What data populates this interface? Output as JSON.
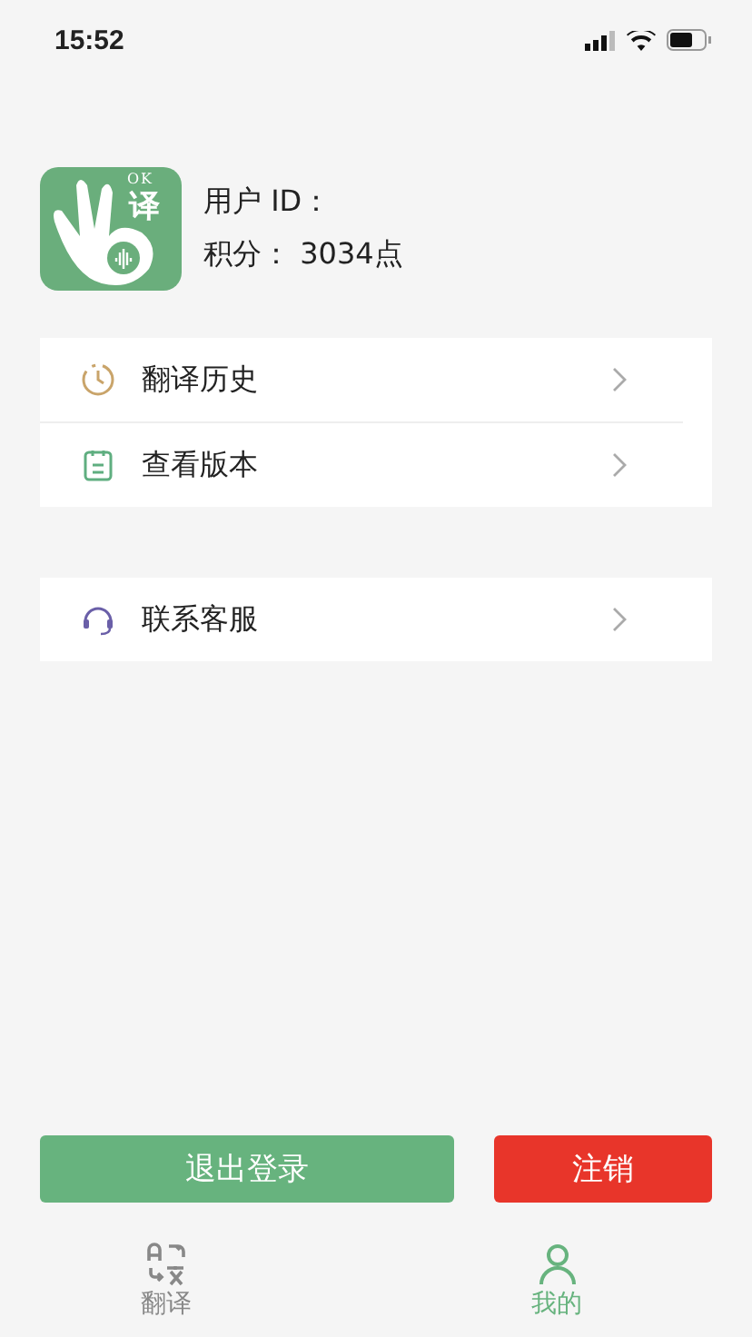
{
  "status_bar": {
    "time": "15:52"
  },
  "profile": {
    "logo_texts": [
      "OK",
      "译"
    ],
    "user_id_label": "用户 ID：",
    "points": "积分：  3034点"
  },
  "menu_groups": [
    {
      "items": [
        {
          "label": "翻译历史",
          "kind": "history"
        },
        {
          "label": "查看版本",
          "kind": "version"
        }
      ]
    },
    {
      "items": [
        {
          "label": "联系客服",
          "kind": "support"
        }
      ]
    }
  ],
  "buttons": [
    {
      "label": "退出登录",
      "kind": "logout"
    },
    {
      "label": "注销",
      "kind": "delete"
    }
  ],
  "tab_bar": [
    {
      "label": "翻译",
      "kind": "translate",
      "selected": false
    },
    {
      "label": "我的",
      "kind": "profile",
      "selected": true
    }
  ]
}
